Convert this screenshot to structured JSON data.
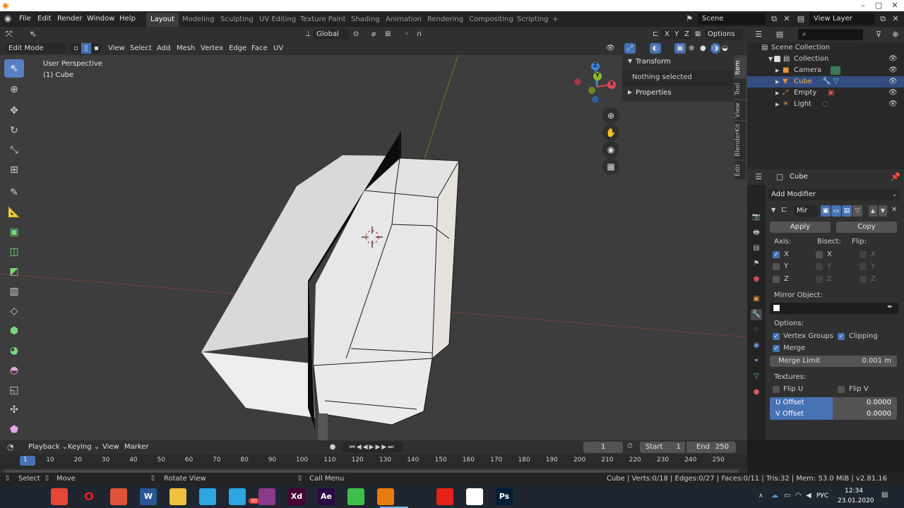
{
  "menu": [
    "File",
    "Edit",
    "Render",
    "Window",
    "Help"
  ],
  "workspaces": [
    {
      "label": "Layout",
      "active": true
    },
    {
      "label": "Modeling"
    },
    {
      "label": "Sculpting"
    },
    {
      "label": "UV Editing"
    },
    {
      "label": "Texture Paint"
    },
    {
      "label": "Shading"
    },
    {
      "label": "Animation"
    },
    {
      "label": "Rendering"
    },
    {
      "label": "Compositing"
    },
    {
      "label": "Scripting"
    }
  ],
  "add_workspace": "+",
  "scene": "Scene",
  "view_layer": "View Layer",
  "viewport": {
    "transform_orientation": "Global",
    "axes": [
      "X",
      "Y",
      "Z"
    ],
    "options": "Options",
    "mode": "Edit Mode",
    "header_menus": [
      "View",
      "Select",
      "Add",
      "Mesh",
      "Vertex",
      "Edge",
      "Face",
      "UV"
    ],
    "overlay_title": "User Perspective",
    "overlay_subtitle": "(1) Cube",
    "gizmo_x": "X",
    "gizmo_y": "Y",
    "gizmo_z": "Z"
  },
  "npanel": {
    "transform": "Transform",
    "nothing_selected": "Nothing selected",
    "properties": "Properties",
    "tabs": [
      "Item",
      "Tool",
      "View",
      "BlenderKit",
      "Edit"
    ]
  },
  "outliner": {
    "root": "Scene Collection",
    "collection": "Collection",
    "items": [
      "Camera",
      "Cube",
      "Empty",
      "Light"
    ]
  },
  "properties": {
    "object": "Cube",
    "add_modifier": "Add Modifier",
    "modifier_name": "Mir",
    "apply": "Apply",
    "copy": "Copy",
    "axis": "Axis:",
    "bisect": "Bisect:",
    "flip": "Flip:",
    "x": "X",
    "y": "Y",
    "z": "Z",
    "mirror_object": "Mirror Object:",
    "options": "Options:",
    "vertex_groups": "Vertex Groups",
    "clipping": "Clipping",
    "merge": "Merge",
    "merge_limit": "Merge Limit",
    "merge_limit_value": "0.001 m",
    "textures": "Textures:",
    "flip_u": "Flip U",
    "flip_v": "Flip V",
    "u_offset": "U Offset",
    "u_offset_value": "0.0000",
    "v_offset": "V Offset",
    "v_offset_value": "0.0000"
  },
  "timeline": {
    "menus": [
      "Playback",
      "Keying",
      "View",
      "Marker"
    ],
    "current_frame": "1",
    "start_label": "Start",
    "start": "1",
    "end_label": "End",
    "end": "250",
    "ruler": [
      "1",
      "10",
      "20",
      "30",
      "40",
      "50",
      "60",
      "70",
      "80",
      "90",
      "100",
      "110",
      "120",
      "130",
      "140",
      "150",
      "160",
      "170",
      "180",
      "190",
      "200",
      "210",
      "220",
      "230",
      "240",
      "250"
    ]
  },
  "status": {
    "select": "Select",
    "move": "Move",
    "rotate": "Rotate View",
    "call_menu": "Call Menu",
    "stats": "Cube | Verts:0/18 | Edges:0/27 | Faces:0/11 | Tris:32 | Mem: 53.0 MiB | v2.81.16"
  },
  "taskbar": {
    "lang": "РУС",
    "time": "12:34",
    "date": "23.01.2020",
    "telegram_badge": "30",
    "apps": [
      {
        "name": "windows-start-icon",
        "label": "",
        "color": "#1f2630"
      },
      {
        "name": "task-view-icon",
        "label": "",
        "color": "#1f2630"
      },
      {
        "name": "chrome-icon",
        "label": "",
        "color": "#e8463a"
      },
      {
        "name": "opera-icon",
        "label": "O",
        "color": "#1f2630"
      },
      {
        "name": "app-red-icon",
        "label": "",
        "color": "#e0533b"
      },
      {
        "name": "word-icon",
        "label": "W",
        "color": "#2b5797"
      },
      {
        "name": "explorer-icon",
        "label": "",
        "color": "#f0c040"
      },
      {
        "name": "telegram-icon",
        "label": "",
        "color": "#2ca5e0"
      },
      {
        "name": "telegram-badge-icon",
        "label": "",
        "color": "#2ca5e0"
      },
      {
        "name": "winrar-icon",
        "label": "",
        "color": "#8a3a8a"
      },
      {
        "name": "xd-icon",
        "label": "Xd",
        "color": "#470137"
      },
      {
        "name": "ae-icon",
        "label": "Ae",
        "color": "#2a0b45"
      },
      {
        "name": "camtasia-icon",
        "label": "",
        "color": "#3fbf4a"
      },
      {
        "name": "blender-icon",
        "label": "",
        "color": "#e87d0d"
      },
      {
        "name": "unity-icon",
        "label": "",
        "color": "#1f2630"
      },
      {
        "name": "youtube-icon",
        "label": "",
        "color": "#e62117"
      },
      {
        "name": "java-icon",
        "label": "",
        "color": "#ffffff"
      },
      {
        "name": "photoshop-icon",
        "label": "Ps",
        "color": "#001e36"
      }
    ]
  },
  "colors": {
    "accent": "#4772b3",
    "selection": "#334d80",
    "viewport_bg": "#3d3d3d"
  }
}
